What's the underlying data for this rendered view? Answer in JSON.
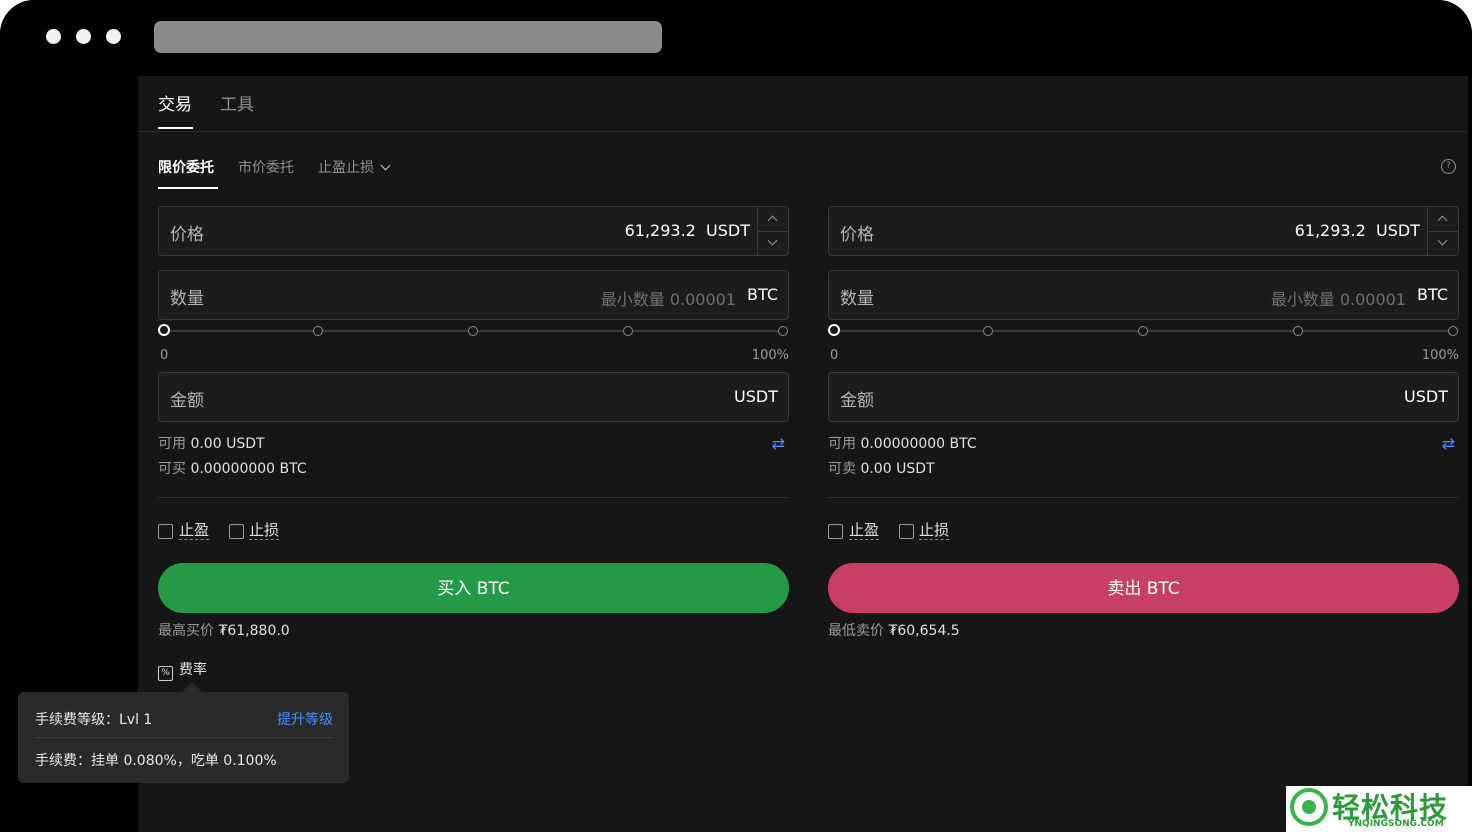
{
  "window": {
    "url": ""
  },
  "tabs": [
    {
      "label": "交易",
      "active": true
    },
    {
      "label": "工具",
      "active": false
    }
  ],
  "order_types": [
    {
      "label": "限价委托",
      "active": true
    },
    {
      "label": "市价委托",
      "active": false
    },
    {
      "label": "止盈止损",
      "active": false,
      "dropdown": true
    }
  ],
  "buy": {
    "price_label": "价格",
    "price_value": "61,293.2",
    "price_unit": "USDT",
    "qty_label": "数量",
    "qty_placeholder": "最小数量 0.00001",
    "qty_unit": "BTC",
    "slider_min": "0",
    "slider_max": "100%",
    "slider_value": 0,
    "amount_label": "金额",
    "amount_unit": "USDT",
    "avail_label": "可用",
    "avail_value": "0.00 USDT",
    "can_label": "可买",
    "can_value": "0.00000000 BTC",
    "tp_label": "止盈",
    "sl_label": "止损",
    "button_label": "买入 BTC",
    "button_color": "#249a48",
    "best_label": "最高买价",
    "best_value": "₮61,880.0"
  },
  "sell": {
    "price_label": "价格",
    "price_value": "61,293.2",
    "price_unit": "USDT",
    "qty_label": "数量",
    "qty_placeholder": "最小数量 0.00001",
    "qty_unit": "BTC",
    "slider_min": "0",
    "slider_max": "100%",
    "slider_value": 0,
    "amount_label": "金额",
    "amount_unit": "USDT",
    "avail_label": "可用",
    "avail_value": "0.00000000 BTC",
    "can_label": "可卖",
    "can_value": "0.00 USDT",
    "tp_label": "止盈",
    "sl_label": "止损",
    "button_label": "卖出 BTC",
    "button_color": "#c73f64",
    "best_label": "最低卖价",
    "best_value": "₮60,654.5"
  },
  "fee": {
    "label": "费率",
    "level_text": "手续费等级：Lvl 1",
    "upgrade_link": "提升等级",
    "rate_text": "手续费：挂单 0.080%，吃单 0.100%"
  },
  "watermark": {
    "text": "轻松科技",
    "sub": "YNQINGSONG.COM",
    "color": "#38b449"
  },
  "colors": {
    "accent_link": "#4a8cff",
    "background": "#161616"
  },
  "icons": {
    "help": "help-circle-icon",
    "swap": "swap-icon",
    "fee": "percent-icon",
    "chevron": "chevron-down-icon"
  }
}
